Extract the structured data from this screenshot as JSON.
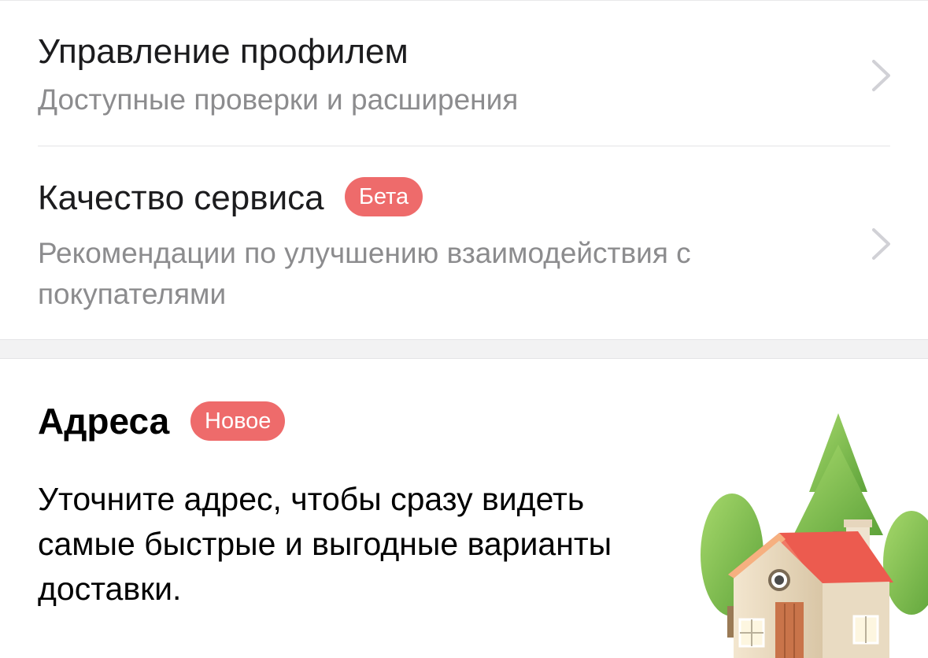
{
  "profile_row": {
    "title": "Управление профилем",
    "subtitle": "Доступные проверки и расширения"
  },
  "quality_row": {
    "title": "Качество сервиса",
    "badge": "Бета",
    "subtitle": "Рекомендации по улучшению взаимодействия с покупателями"
  },
  "addresses": {
    "title": "Адреса",
    "badge": "Новое",
    "description": "Уточните адрес, чтобы сразу видеть самые быстрые и выгодные варианты доставки."
  },
  "icons": {
    "chevron": "chevron-right-icon",
    "illustration": "house-with-trees-illustration"
  },
  "colors": {
    "badge": "#ee6b6b",
    "title": "#1c1c1e",
    "subtitle": "#8c8c8e",
    "separator_bg": "#f2f2f3"
  }
}
